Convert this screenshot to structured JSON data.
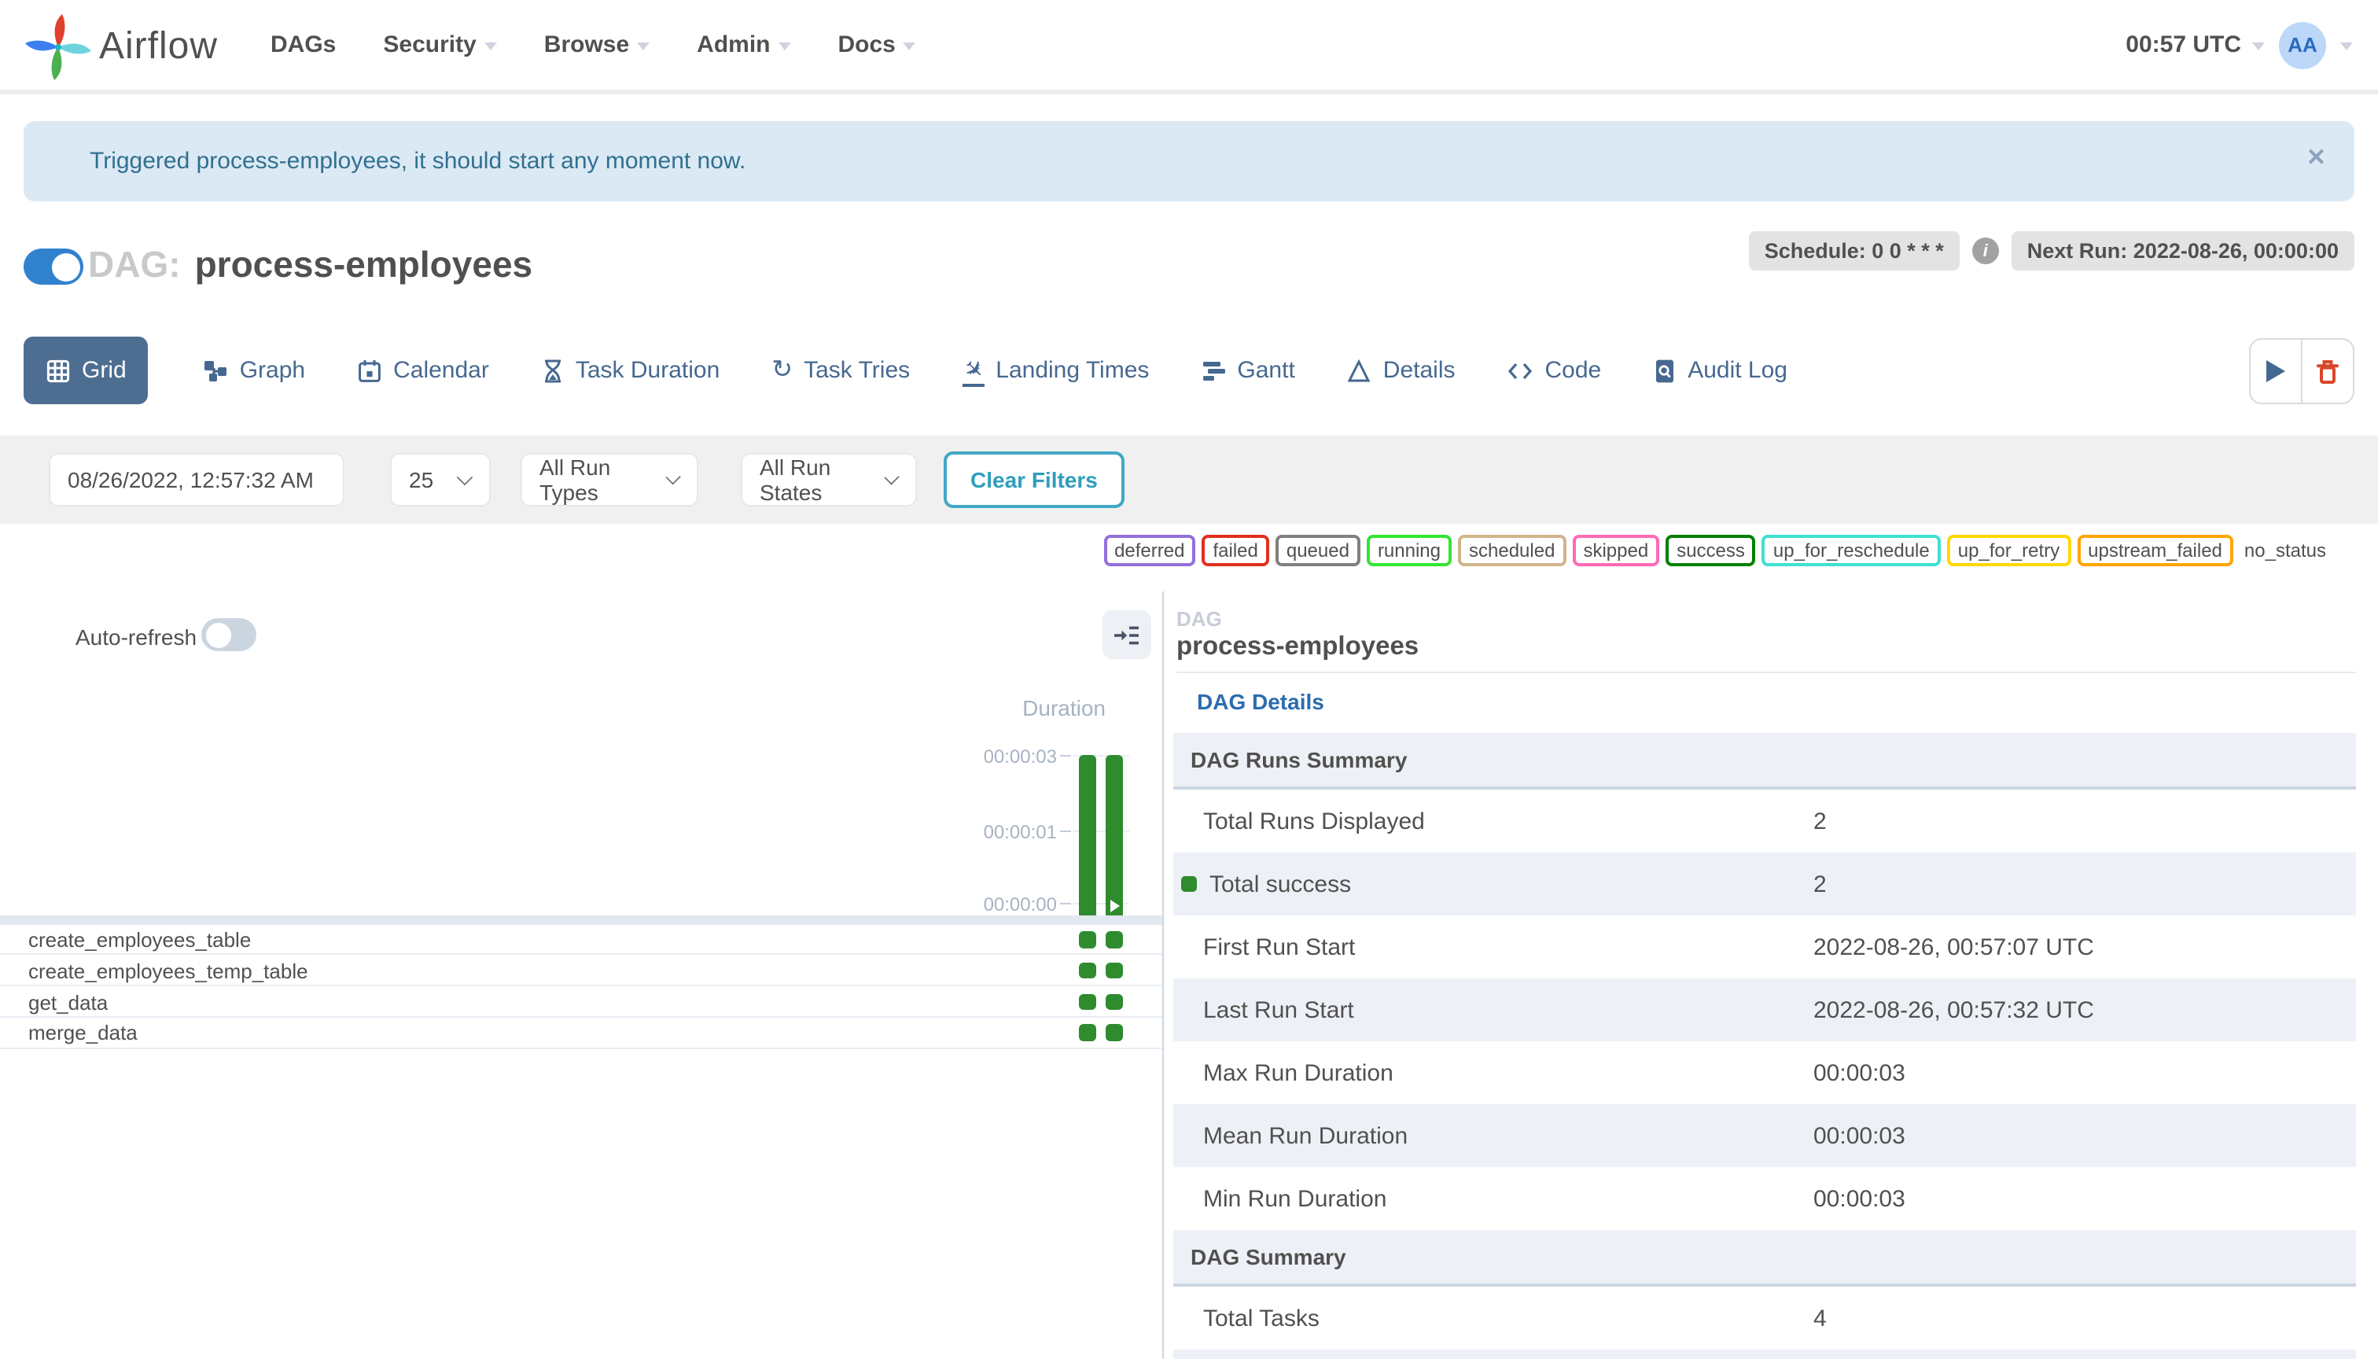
{
  "colors": {
    "accent": "#3182ce",
    "link_blue": "#2b6cb0",
    "success": "#2e8b2e",
    "active_tab_bg": "#4d6e91",
    "tab_text": "#466890",
    "alert_bg": "#dbe9f4",
    "alert_text": "#31708f",
    "clear_filters": "#2f9ebc",
    "danger_red": "#d9472b",
    "avatar_bg": "#bcd7f7"
  },
  "icons": {
    "close": "✕",
    "info": "i",
    "retry": "↻",
    "plane": "✈"
  },
  "navbar": {
    "brand": "Airflow",
    "menu": [
      {
        "label": "DAGs",
        "has_caret": false
      },
      {
        "label": "Security",
        "has_caret": true
      },
      {
        "label": "Browse",
        "has_caret": true
      },
      {
        "label": "Admin",
        "has_caret": true
      },
      {
        "label": "Docs",
        "has_caret": true
      }
    ],
    "clock": "00:57 UTC",
    "avatar": "AA"
  },
  "alert": {
    "message": "Triggered process-employees, it should start any moment now."
  },
  "dag_header": {
    "label": "DAG:",
    "name": "process-employees",
    "schedule": "Schedule: 0 0 * * *",
    "next_run": "Next Run: 2022-08-26, 00:00:00"
  },
  "tabs": [
    {
      "label": "Grid",
      "active": true
    },
    {
      "label": "Graph",
      "active": false
    },
    {
      "label": "Calendar",
      "active": false
    },
    {
      "label": "Task Duration",
      "active": false
    },
    {
      "label": "Task Tries",
      "active": false
    },
    {
      "label": "Landing Times",
      "active": false
    },
    {
      "label": "Gantt",
      "active": false
    },
    {
      "label": "Details",
      "active": false
    },
    {
      "label": "Code",
      "active": false
    },
    {
      "label": "Audit Log",
      "active": false
    }
  ],
  "filters": {
    "date": "08/26/2022, 12:57:32 AM",
    "limit": "25",
    "run_types": "All Run Types",
    "run_states": "All Run States",
    "clear": "Clear Filters"
  },
  "legend": [
    {
      "label": "deferred",
      "color": "#9370DB"
    },
    {
      "label": "failed",
      "color": "#e0301e"
    },
    {
      "label": "queued",
      "color": "#808080"
    },
    {
      "label": "running",
      "color": "#32e532"
    },
    {
      "label": "scheduled",
      "color": "#d2b48c"
    },
    {
      "label": "skipped",
      "color": "#ff69b4"
    },
    {
      "label": "success",
      "color": "#008000"
    },
    {
      "label": "up_for_reschedule",
      "color": "#40e0d0"
    },
    {
      "label": "up_for_retry",
      "color": "#ffd700"
    },
    {
      "label": "upstream_failed",
      "color": "#ffa500"
    },
    {
      "label": "no_status",
      "color": null
    }
  ],
  "grid_panel": {
    "auto_refresh": "Auto-refresh",
    "duration_label": "Duration",
    "axis_ticks": [
      "00:00:03",
      "00:00:01",
      "00:00:00"
    ],
    "runs": [
      {
        "duration": "00:00:03",
        "state": "success",
        "manual": false
      },
      {
        "duration": "00:00:03",
        "state": "success",
        "manual": true
      }
    ],
    "tasks": [
      "create_employees_table",
      "create_employees_temp_table",
      "get_data",
      "merge_data"
    ]
  },
  "details_panel": {
    "panel_label": "DAG",
    "dag_name": "process-employees",
    "active_tab": "DAG Details",
    "sections": [
      {
        "header": "DAG Runs Summary",
        "rows": [
          {
            "label": "Total Runs Displayed",
            "value": "2"
          },
          {
            "label": "Total success",
            "value": "2",
            "marker_color": "#2e8b2e"
          },
          {
            "label": "First Run Start",
            "value": "2022-08-26, 00:57:07 UTC"
          },
          {
            "label": "Last Run Start",
            "value": "2022-08-26, 00:57:32 UTC"
          },
          {
            "label": "Max Run Duration",
            "value": "00:00:03"
          },
          {
            "label": "Mean Run Duration",
            "value": "00:00:03"
          },
          {
            "label": "Min Run Duration",
            "value": "00:00:03"
          }
        ]
      },
      {
        "header": "DAG Summary",
        "rows": [
          {
            "label": "Total Tasks",
            "value": "4"
          }
        ]
      }
    ]
  }
}
